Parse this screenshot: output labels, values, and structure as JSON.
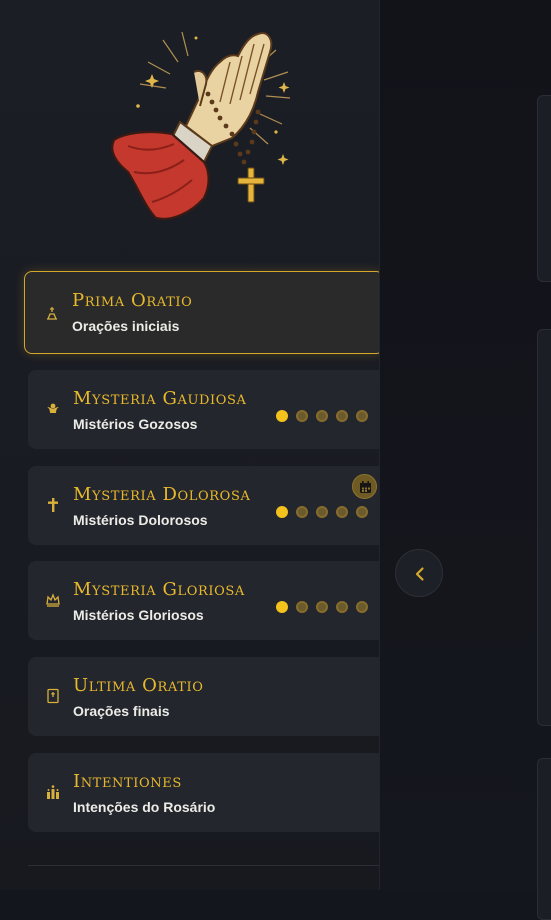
{
  "colors": {
    "accent": "#e8b92b",
    "dot_done": "#f3c21d",
    "dot_pending": "#6b5a2c",
    "active_border": "#d4a82a"
  },
  "illustration": {
    "icon": "praying-hands-with-rosary-icon"
  },
  "menu": [
    {
      "title": "Prima Oratio",
      "subtitle": "Orações iniciais",
      "icon": "kneeling-prayer-icon",
      "active": true
    },
    {
      "title": "Mysteria Gaudiosa",
      "subtitle": "Mistérios Gozosos",
      "icon": "angel-icon",
      "progress": {
        "done": 1,
        "total": 5
      }
    },
    {
      "title": "Mysteria Dolorosa",
      "subtitle": "Mistérios Dolorosos",
      "icon": "cross-icon",
      "progress": {
        "done": 1,
        "total": 5
      },
      "badge": "calendar-icon"
    },
    {
      "title": "Mysteria Gloriosa",
      "subtitle": "Mistérios Gloriosos",
      "icon": "crown-icon",
      "progress": {
        "done": 1,
        "total": 5
      }
    },
    {
      "title": "Ultima Oratio",
      "subtitle": "Orações finais",
      "icon": "bible-icon"
    },
    {
      "title": "Intentiones",
      "subtitle": "Intenções do Rosário",
      "icon": "candles-icon"
    }
  ],
  "collapse_button": {
    "icon": "chevron-left-icon"
  }
}
